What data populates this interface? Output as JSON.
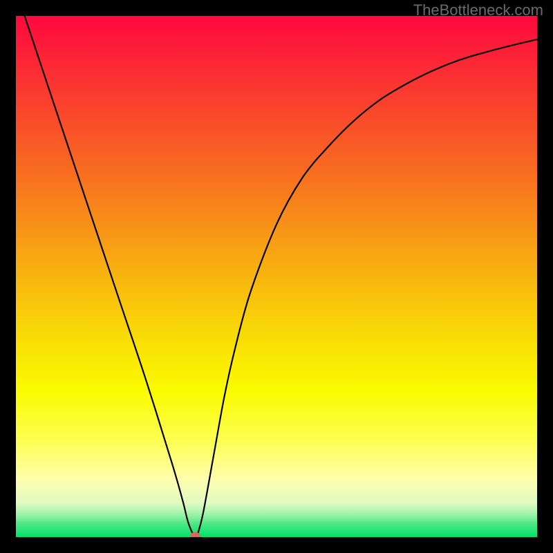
{
  "watermark": "TheBottleneck.com",
  "chart_data": {
    "type": "line",
    "title": "",
    "xlabel": "",
    "ylabel": "",
    "xlim": [
      0,
      100
    ],
    "ylim": [
      0,
      100
    ],
    "background_gradient": {
      "stops": [
        {
          "offset": 0.0,
          "color": "#fe093e"
        },
        {
          "offset": 0.15,
          "color": "#fb3b2f"
        },
        {
          "offset": 0.3,
          "color": "#f86d20"
        },
        {
          "offset": 0.45,
          "color": "#f8a313"
        },
        {
          "offset": 0.6,
          "color": "#f9d707"
        },
        {
          "offset": 0.72,
          "color": "#fafc00"
        },
        {
          "offset": 0.82,
          "color": "#fcfe57"
        },
        {
          "offset": 0.89,
          "color": "#fefeae"
        },
        {
          "offset": 0.935,
          "color": "#e1fac3"
        },
        {
          "offset": 0.955,
          "color": "#a3f3ab"
        },
        {
          "offset": 0.975,
          "color": "#4be884"
        },
        {
          "offset": 1.0,
          "color": "#00e169"
        }
      ]
    },
    "series": [
      {
        "name": "bottleneck-curve",
        "x": [
          0,
          5,
          10,
          15,
          20,
          25,
          30,
          32,
          33,
          34,
          34.5,
          35,
          36,
          38,
          40,
          42,
          45,
          50,
          55,
          60,
          65,
          70,
          75,
          80,
          85,
          90,
          95,
          100
        ],
        "y": [
          105,
          90,
          75,
          60,
          45,
          30,
          14,
          7,
          3,
          0.5,
          0,
          1,
          5,
          16,
          27,
          36,
          47,
          60,
          69,
          75,
          80,
          84,
          87,
          89.5,
          91.5,
          93,
          94.3,
          95.5
        ]
      }
    ],
    "marker": {
      "name": "optimal-point",
      "x": 34.4,
      "y": 0.3,
      "color": "#d5695c",
      "rx": 7,
      "ry": 5
    }
  }
}
